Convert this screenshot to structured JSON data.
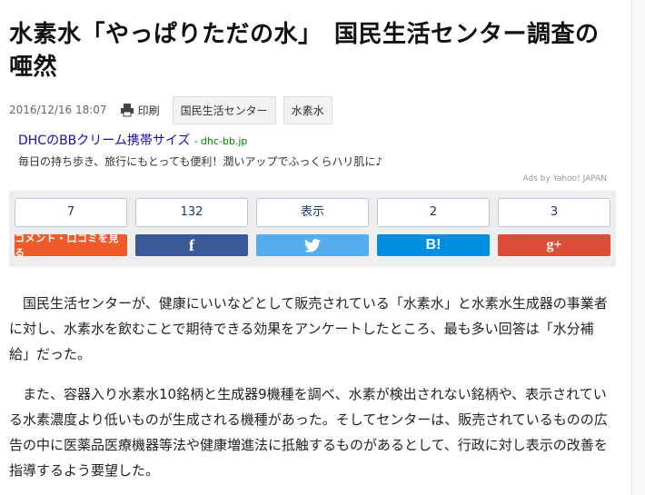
{
  "headline": "水素水「やっぱりただの水」　国民生活センター調査の唖然",
  "meta": {
    "date": "2016/12/16 18:07",
    "print_label": "印刷",
    "tags": [
      "国民生活センター",
      "水素水"
    ]
  },
  "ad": {
    "title": "DHCのBBクリーム携帯サイズ",
    "url": "- dhc-bb.jp",
    "description": "毎日の持ち歩き、旅行にもとっても便利！潤いアップでふっくらハリ肌に♪",
    "credit": "Ads by Yahoo! JAPAN"
  },
  "share": {
    "counts": [
      "7",
      "132",
      "表示",
      "2",
      "3"
    ],
    "comment_label": "コメント・口コミを見る",
    "facebook_label": "f",
    "hatena_label": "B!",
    "gplus_label": "g+"
  },
  "body": {
    "paragraphs": [
      "国民生活センターが、健康にいいなどとして販売されている「水素水」と水素水生成器の事業者に対し、水素水を飲むことで期待できる効果をアンケートしたところ、最も多い回答は「水分補給」だった。",
      "また、容器入り水素水10銘柄と生成器9機種を調べ、水素が検出されない銘柄や、表示されている水素濃度より低いものが生成される機種があった。そしてセンターは、販売されているものの広告の中に医薬品医療機器等法や健康増進法に抵触するものがあるとして、行政に対し表示の改善を指導するよう要望した。"
    ]
  },
  "colors": {
    "comment": "#f05a2a",
    "facebook": "#3b5998",
    "twitter": "#55acee",
    "hatena": "#008fde",
    "gplus": "#dd4b39"
  },
  "icons": [
    "print-icon",
    "facebook-icon",
    "twitter-icon",
    "hatena-icon",
    "google-plus-icon"
  ]
}
